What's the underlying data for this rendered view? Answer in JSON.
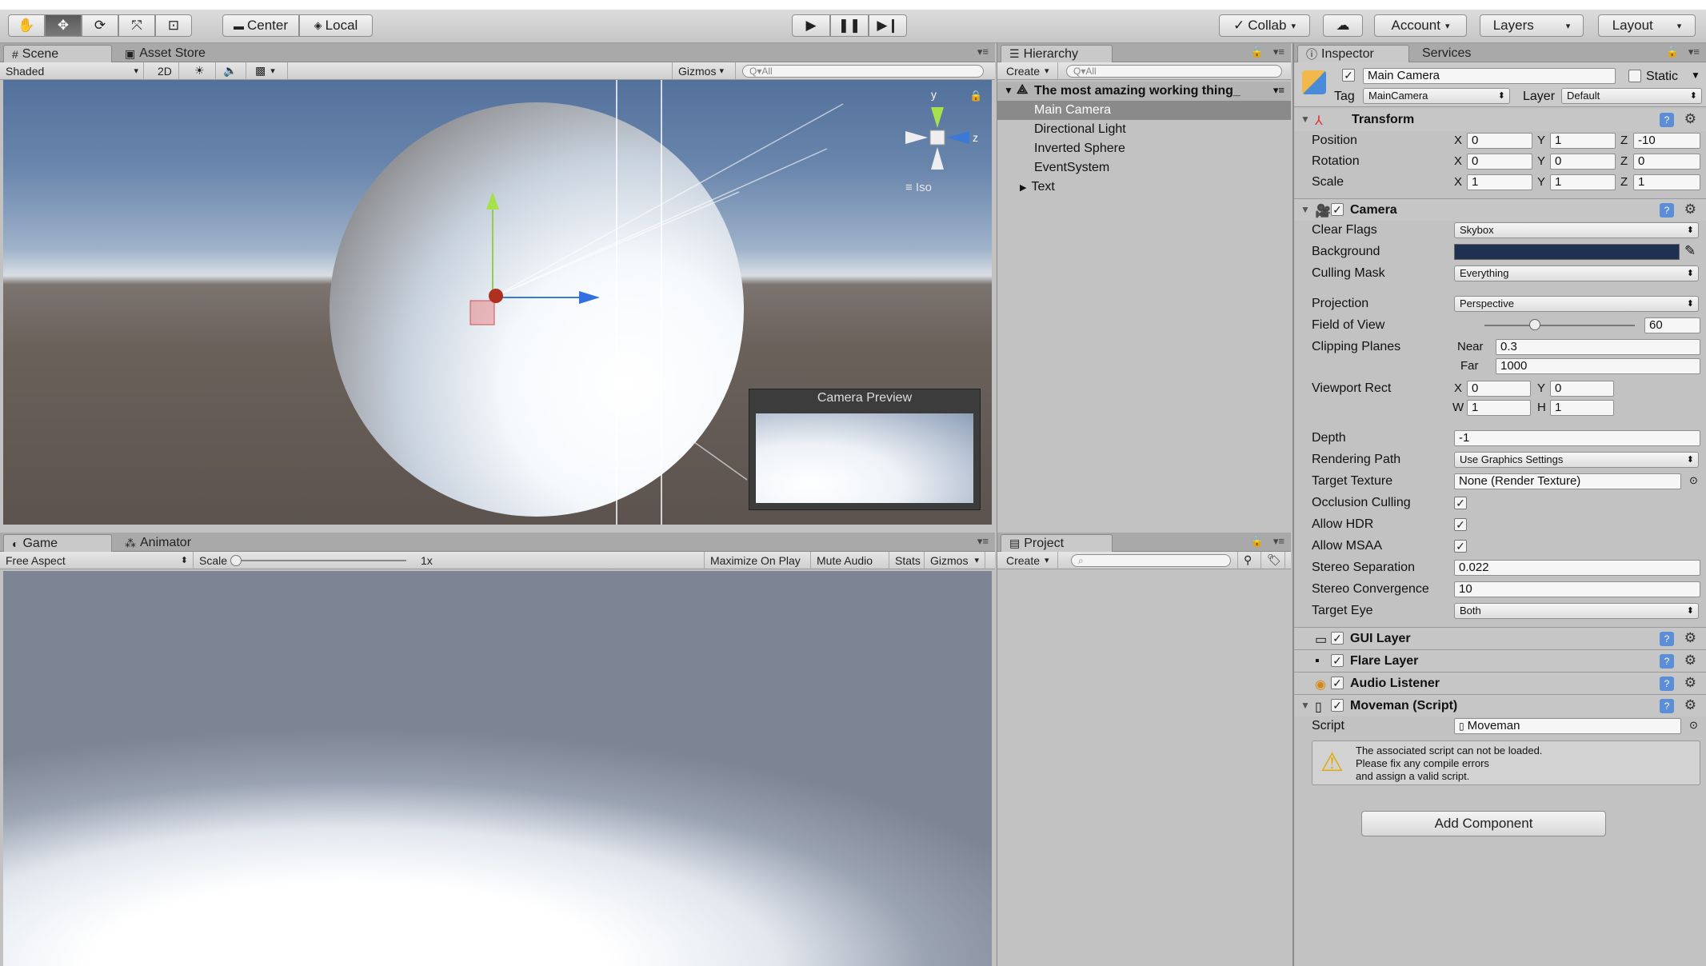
{
  "toolbar": {
    "pivot": "Center",
    "space": "Local",
    "collab": "Collab",
    "account": "Account",
    "layers": "Layers",
    "layout": "Layout"
  },
  "scene": {
    "tab_scene": "Scene",
    "tab_asset_store": "Asset Store",
    "shading_mode": "Shaded",
    "mode_2d": "2D",
    "gizmos": "Gizmos",
    "search_placeholder": "Q▾All",
    "iso": "Iso",
    "axis_y": "y",
    "axis_z": "z",
    "camera_preview": "Camera Preview"
  },
  "game": {
    "tab_game": "Game",
    "tab_animator": "Animator",
    "aspect": "Free Aspect",
    "scale_label": "Scale",
    "scale_value": "1x",
    "maximize": "Maximize On Play",
    "mute": "Mute Audio",
    "stats": "Stats",
    "gizmos": "Gizmos"
  },
  "hierarchy": {
    "tab": "Hierarchy",
    "create": "Create",
    "search_placeholder": "Q▾All",
    "scene_name": "The most amazing working thing_",
    "items": [
      {
        "label": "Main Camera"
      },
      {
        "label": "Directional Light"
      },
      {
        "label": "Inverted Sphere"
      },
      {
        "label": "EventSystem"
      },
      {
        "label": "Text"
      }
    ]
  },
  "project": {
    "tab": "Project",
    "create": "Create"
  },
  "inspector": {
    "tab_inspector": "Inspector",
    "tab_services": "Services",
    "object_name": "Main Camera",
    "static_label": "Static",
    "tag_label": "Tag",
    "tag_value": "MainCamera",
    "layer_label": "Layer",
    "layer_value": "Default",
    "transform": {
      "title": "Transform",
      "position_label": "Position",
      "rotation_label": "Rotation",
      "scale_label": "Scale",
      "position": {
        "x": "0",
        "y": "1",
        "z": "-10"
      },
      "rotation": {
        "x": "0",
        "y": "0",
        "z": "0"
      },
      "scale": {
        "x": "1",
        "y": "1",
        "z": "1"
      }
    },
    "camera": {
      "title": "Camera",
      "clear_flags_label": "Clear Flags",
      "clear_flags": "Skybox",
      "background_label": "Background",
      "background_color": "#1f3150",
      "culling_mask_label": "Culling Mask",
      "culling_mask": "Everything",
      "projection_label": "Projection",
      "projection": "Perspective",
      "fov_label": "Field of View",
      "fov": "60",
      "fov_value": 60,
      "fov_max": 179,
      "clipping_label": "Clipping Planes",
      "near_label": "Near",
      "near": "0.3",
      "far_label": "Far",
      "far": "1000",
      "viewport_label": "Viewport Rect",
      "vp_x": "0",
      "vp_y": "0",
      "vp_w": "1",
      "vp_h": "1",
      "depth_label": "Depth",
      "depth": "-1",
      "rendering_path_label": "Rendering Path",
      "rendering_path": "Use Graphics Settings",
      "target_texture_label": "Target Texture",
      "target_texture": "None (Render Texture)",
      "occlusion_label": "Occlusion Culling",
      "hdr_label": "Allow HDR",
      "msaa_label": "Allow MSAA",
      "stereo_sep_label": "Stereo Separation",
      "stereo_sep": "0.022",
      "stereo_conv_label": "Stereo Convergence",
      "stereo_conv": "10",
      "target_eye_label": "Target Eye",
      "target_eye": "Both"
    },
    "gui_layer": "GUI Layer",
    "flare_layer": "Flare Layer",
    "audio_listener": "Audio Listener",
    "moveman": {
      "title": "Moveman (Script)",
      "script_label": "Script",
      "script_value": "Moveman",
      "warning_1": "The associated script can not be loaded.",
      "warning_2": "Please fix any compile errors",
      "warning_3": "and assign a valid script."
    },
    "add_component": "Add Component"
  }
}
